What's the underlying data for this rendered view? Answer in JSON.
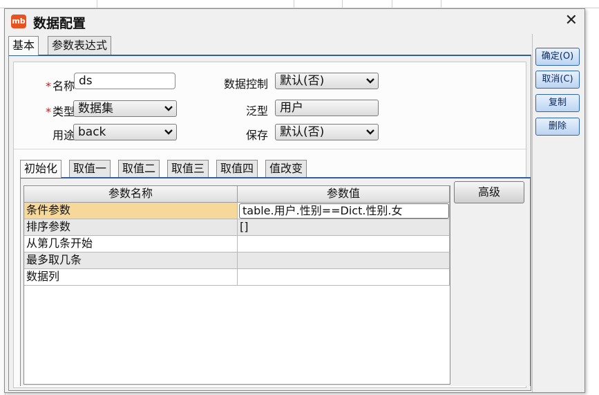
{
  "window": {
    "app_icon_text": "mb",
    "title": "数据配置",
    "close_symbol": "✕"
  },
  "outer_tabs": [
    {
      "label": "基本",
      "active": true
    },
    {
      "label": "参数表达式",
      "active": false
    }
  ],
  "form": {
    "required_mark": "*",
    "name_label": "名称",
    "name_value": "ds",
    "type_label": "类型",
    "type_value": "数据集",
    "usage_label": "用途",
    "usage_value": "back",
    "data_control_label": "数据控制",
    "data_control_value": "默认(否)",
    "generic_label": "泛型",
    "generic_value": "用户",
    "save_label": "保存",
    "save_value": "默认(否)"
  },
  "inner_tabs": [
    {
      "label": "初始化",
      "active": true
    },
    {
      "label": "取值一",
      "active": false
    },
    {
      "label": "取值二",
      "active": false
    },
    {
      "label": "取值三",
      "active": false
    },
    {
      "label": "取值四",
      "active": false
    },
    {
      "label": "值改变",
      "active": false
    }
  ],
  "grid": {
    "columns": [
      "参数名称",
      "参数值"
    ],
    "rows": [
      {
        "name": "条件参数",
        "value": "table.用户.性别==Dict.性别.女"
      },
      {
        "name": "排序参数",
        "value": "[]"
      },
      {
        "name": "从第几条开始",
        "value": ""
      },
      {
        "name": "最多取几条",
        "value": ""
      },
      {
        "name": "数据列",
        "value": ""
      }
    ]
  },
  "advanced_button": "高级",
  "side_buttons": {
    "ok": "确定(O)",
    "cancel": "取消(C)",
    "copy": "复制",
    "delete": "删除"
  },
  "colors": {
    "accent_blue": "#2f5e9e",
    "selected_row": "#f7d89b",
    "required": "#c81a1a",
    "app_icon": "#e8521e"
  }
}
